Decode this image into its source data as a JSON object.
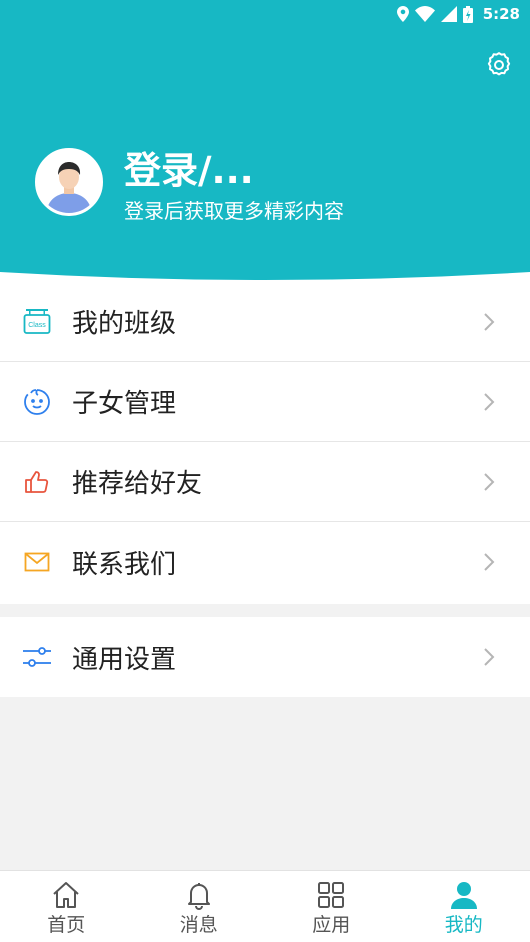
{
  "status_bar": {
    "time": "5:28"
  },
  "header": {
    "title": "登录/...",
    "subtitle": "登录后获取更多精彩内容",
    "settings_icon": "gear-icon",
    "bg_color": "#17b8c4"
  },
  "menu": {
    "group1": [
      {
        "label": "我的班级",
        "icon": "class-icon"
      },
      {
        "label": "子女管理",
        "icon": "child-face-icon"
      },
      {
        "label": "推荐给好友",
        "icon": "thumbs-up-icon"
      },
      {
        "label": "联系我们",
        "icon": "mail-icon"
      }
    ],
    "group2": [
      {
        "label": "通用设置",
        "icon": "sliders-icon"
      }
    ]
  },
  "bottom_nav": {
    "items": [
      {
        "label": "首页",
        "icon": "home-icon",
        "active": false
      },
      {
        "label": "消息",
        "icon": "bell-icon",
        "active": false
      },
      {
        "label": "应用",
        "icon": "grid-icon",
        "active": false
      },
      {
        "label": "我的",
        "icon": "person-icon",
        "active": true
      }
    ]
  },
  "colors": {
    "accent": "#17b8c4",
    "thumb": "#e8553e",
    "mail": "#f5a623",
    "sliders": "#2f80ed"
  }
}
